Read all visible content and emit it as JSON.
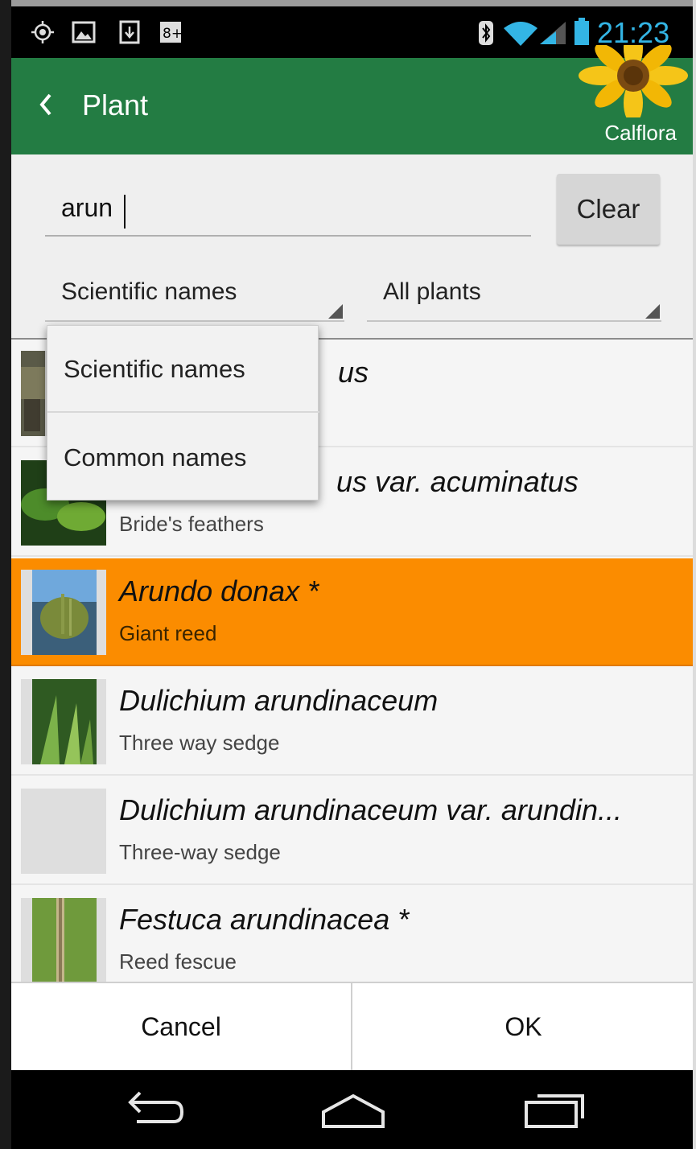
{
  "status_bar": {
    "time": "21:23",
    "icons": [
      "gps-icon",
      "photo-icon",
      "download-icon",
      "google-plus-icon",
      "bluetooth-icon",
      "wifi-icon",
      "cell-signal-icon",
      "battery-icon"
    ]
  },
  "action_bar": {
    "title": "Plant",
    "brand_label": "Calflora",
    "color": "#237c43"
  },
  "search": {
    "value": "arun",
    "clear_label": "Clear",
    "name_type_selected": "Scientific names",
    "filter_selected": "All plants"
  },
  "dropdown": {
    "options": [
      "Scientific names",
      "Common names"
    ]
  },
  "plants": [
    {
      "scientific": "Arundo aureus",
      "common": ""
    },
    {
      "scientific": "Aruncus dioicus var. acuminatus",
      "common": "Bride's feathers"
    },
    {
      "scientific": "Arundo donax *",
      "common": "Giant reed",
      "selected": true
    },
    {
      "scientific": "Dulichium arundinaceum",
      "common": "Three way sedge"
    },
    {
      "scientific": "Dulichium arundinaceum var. arundin...",
      "common": "Three-way sedge"
    },
    {
      "scientific": "Festuca arundinacea *",
      "common": "Reed fescue"
    }
  ],
  "visible_fragments": {
    "row0_tail": "us",
    "row1_tail": "us var. acuminatus"
  },
  "bottom_buttons": {
    "cancel": "Cancel",
    "ok": "OK"
  },
  "colors": {
    "selected_row": "#fb8c00",
    "status_time": "#33b5e5"
  }
}
